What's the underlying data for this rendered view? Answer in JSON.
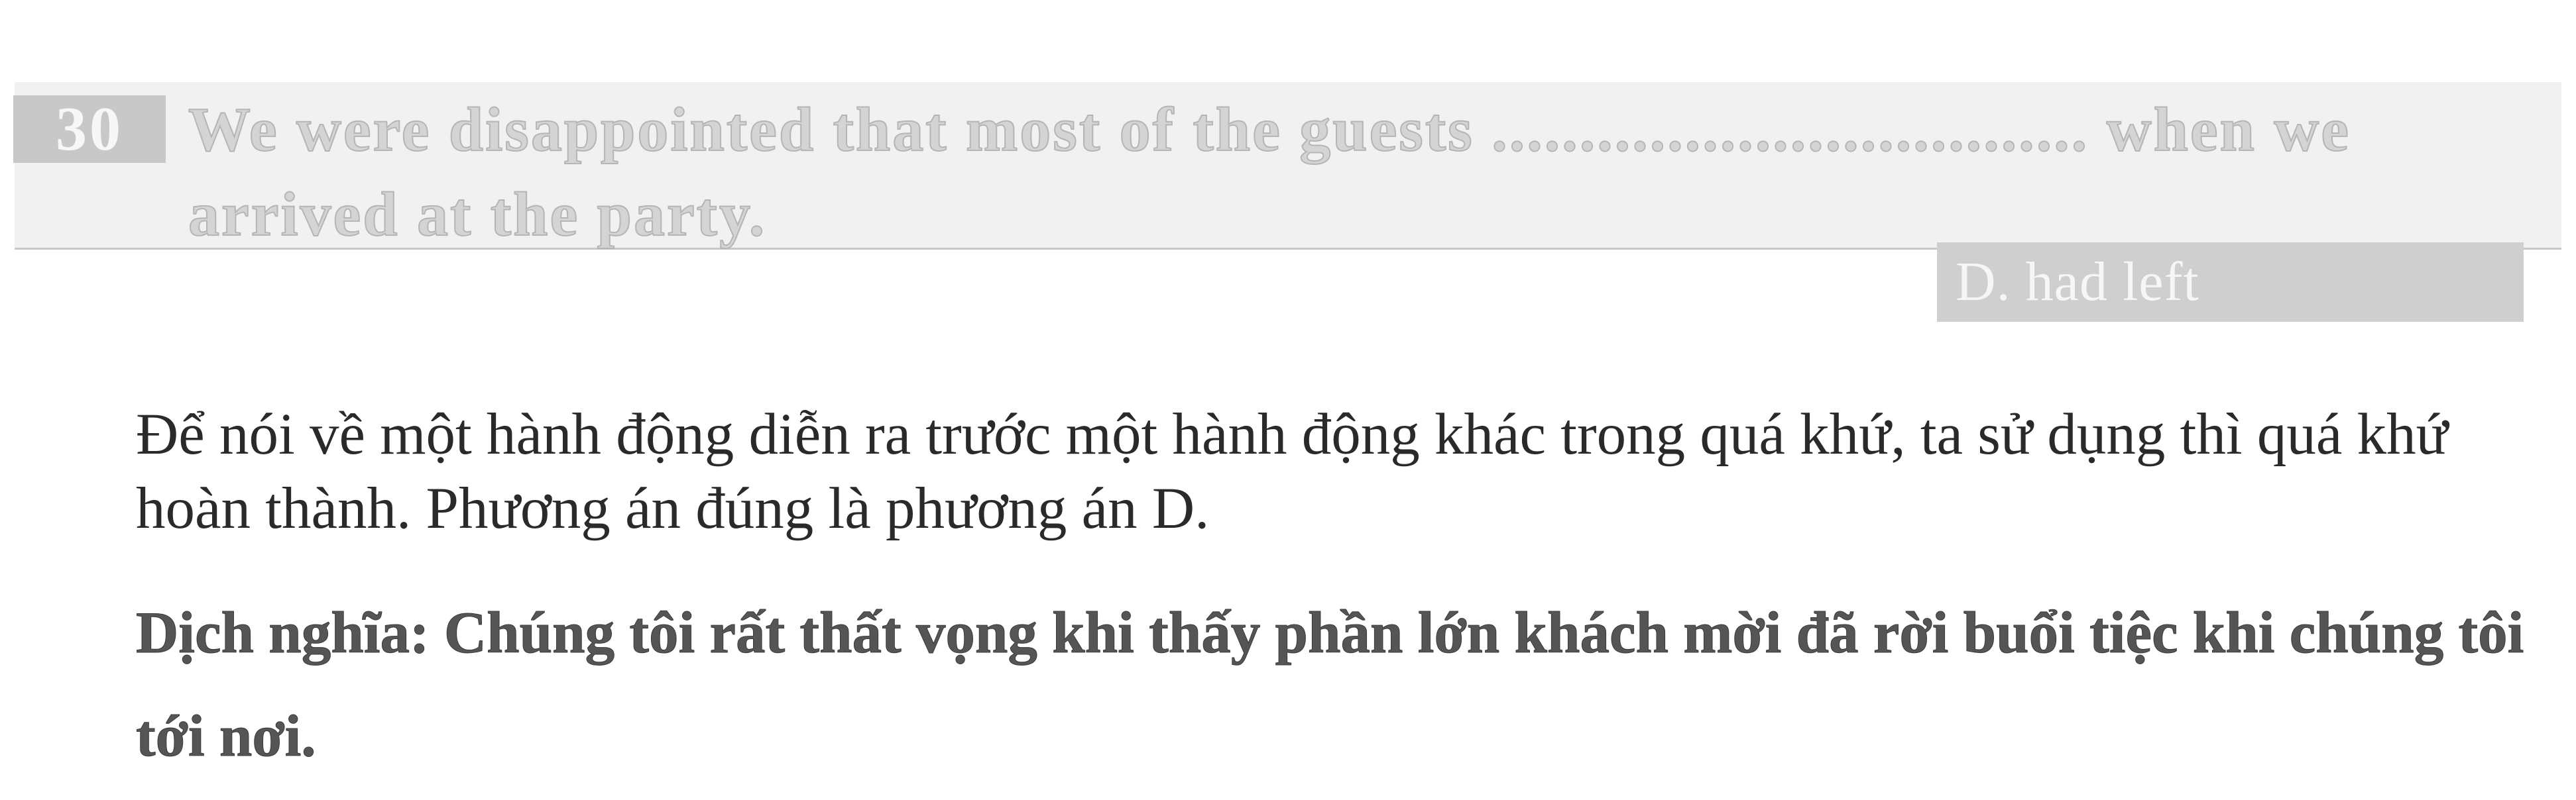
{
  "question": {
    "number": "30",
    "text": "We were disappointed that most of the guests .................................. when we arrived at the party."
  },
  "answer": {
    "label": "D. had left"
  },
  "explanation": {
    "text": "Để nói về một hành động diễn ra trước một hành động khác trong quá khứ, ta sử dụng thì quá khứ hoàn thành. Phương án đúng là phương án D."
  },
  "translation": {
    "text": "Dịch nghĩa: Chúng tôi rất thất vọng khi thấy phần lớn khách mời đã rời buổi tiệc khi chúng tôi tới nơi."
  },
  "colors": {
    "band_background": "#f1f1f1",
    "number_box": "#c8c8c8",
    "answer_chip": "#cfcfcf",
    "body_text": "#2a2a2a"
  }
}
